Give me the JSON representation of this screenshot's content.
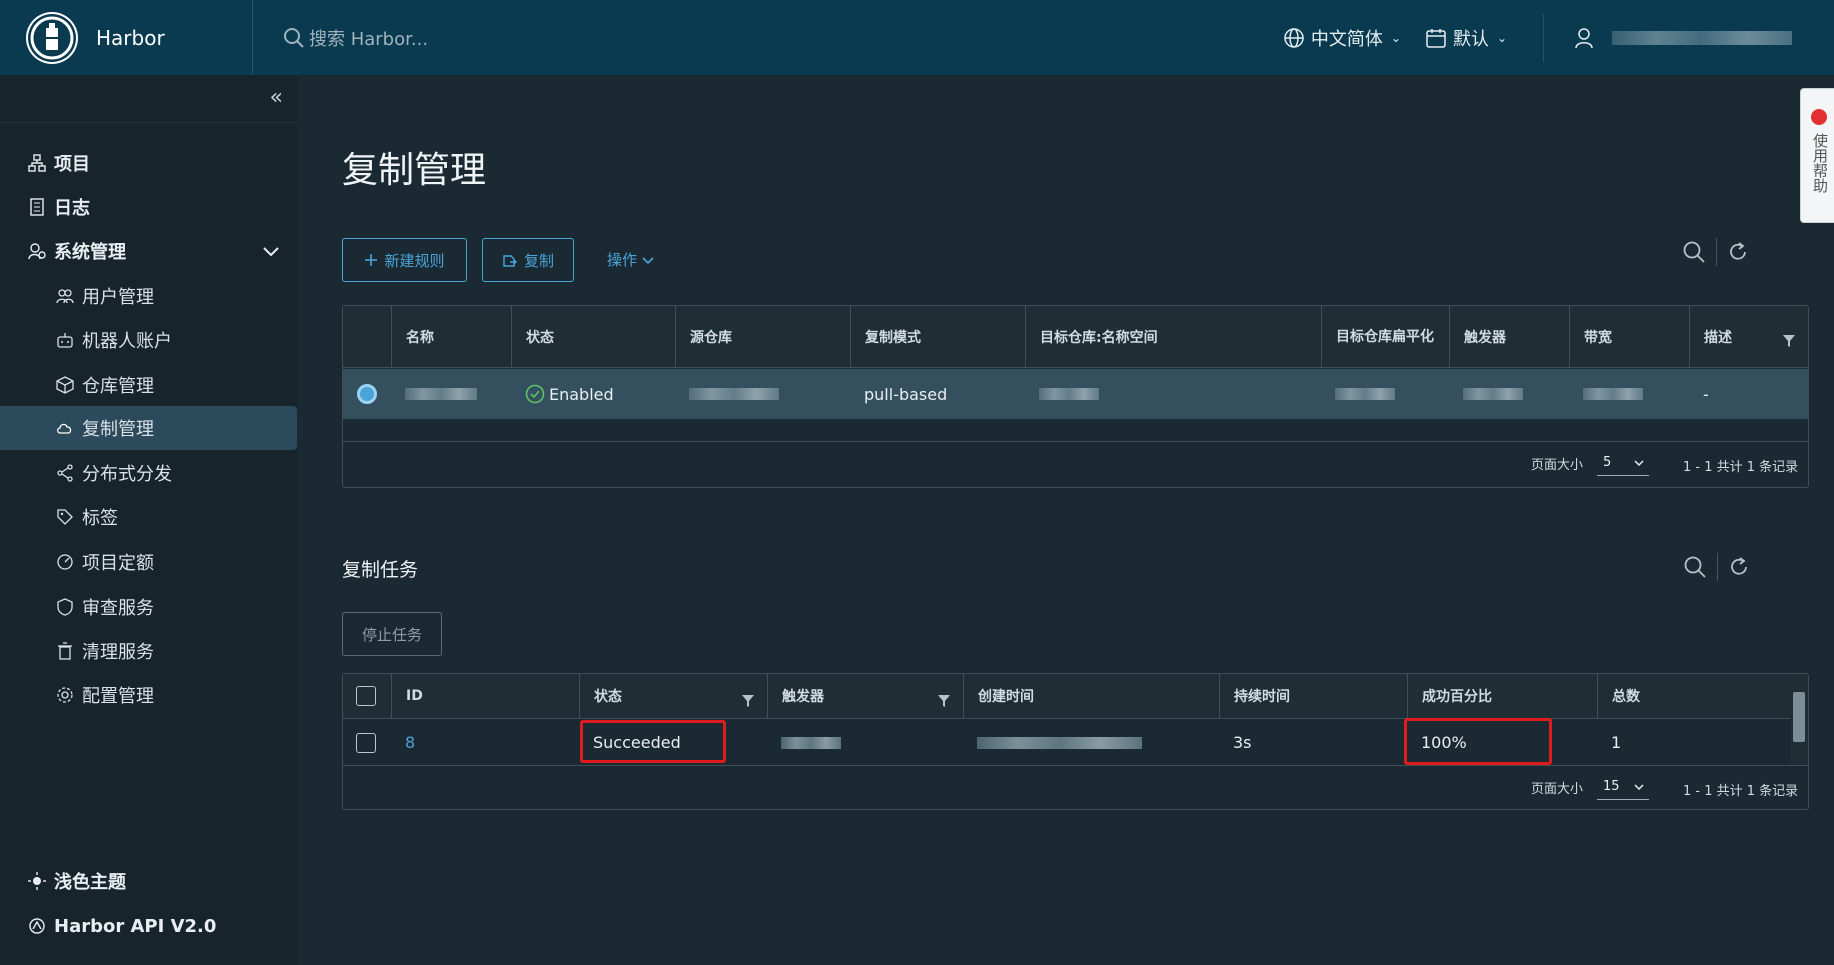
{
  "header": {
    "brand": "Harbor",
    "search_placeholder": "搜索 Harbor...",
    "language": "中文简体",
    "datetime_format": "默认"
  },
  "sidebar": {
    "items": [
      {
        "label": "项目",
        "icon": "project-icon"
      },
      {
        "label": "日志",
        "icon": "log-icon"
      },
      {
        "label": "系统管理",
        "icon": "admin-icon"
      },
      {
        "label": "用户管理",
        "icon": "users-icon"
      },
      {
        "label": "机器人账户",
        "icon": "robot-icon"
      },
      {
        "label": "仓库管理",
        "icon": "registry-icon"
      },
      {
        "label": "复制管理",
        "icon": "replication-icon"
      },
      {
        "label": "分布式分发",
        "icon": "distribution-icon"
      },
      {
        "label": "标签",
        "icon": "tag-icon"
      },
      {
        "label": "项目定额",
        "icon": "quota-icon"
      },
      {
        "label": "审查服务",
        "icon": "scanner-icon"
      },
      {
        "label": "清理服务",
        "icon": "cleanup-icon"
      },
      {
        "label": "配置管理",
        "icon": "config-icon"
      }
    ],
    "theme_label": "浅色主题",
    "api_label": "Harbor API V2.0"
  },
  "main": {
    "title": "复制管理",
    "new_rule_button": "新建规则",
    "replicate_button": "复制",
    "actions_label": "操作",
    "rules_table": {
      "columns": [
        "名称",
        "状态",
        "源仓库",
        "复制模式",
        "目标仓库:名称空间",
        "目标仓库扁平化",
        "触发器",
        "带宽",
        "描述"
      ],
      "rows": [
        {
          "status": "Enabled",
          "mode": "pull-based",
          "description": "-"
        }
      ],
      "page_size_label": "页面大小",
      "page_size": "5",
      "total": "1 - 1 共计 1 条记录"
    },
    "tasks_title": "复制任务",
    "stop_button": "停止任务",
    "tasks_table": {
      "columns": [
        "ID",
        "状态",
        "触发器",
        "创建时间",
        "持续时间",
        "成功百分比",
        "总数"
      ],
      "rows": [
        {
          "id": "8",
          "status": "Succeeded",
          "duration": "3s",
          "success_rate": "100%",
          "total": "1"
        }
      ],
      "page_size_label": "页面大小",
      "page_size": "15",
      "total": "1 - 1 共计 1 条记录"
    }
  },
  "feedback": {
    "label": "使用帮助"
  },
  "colors": {
    "header": "#0a3a4f",
    "accent": "#4aa3d9",
    "highlight": "#e01b1b",
    "success": "#5cc36a"
  }
}
